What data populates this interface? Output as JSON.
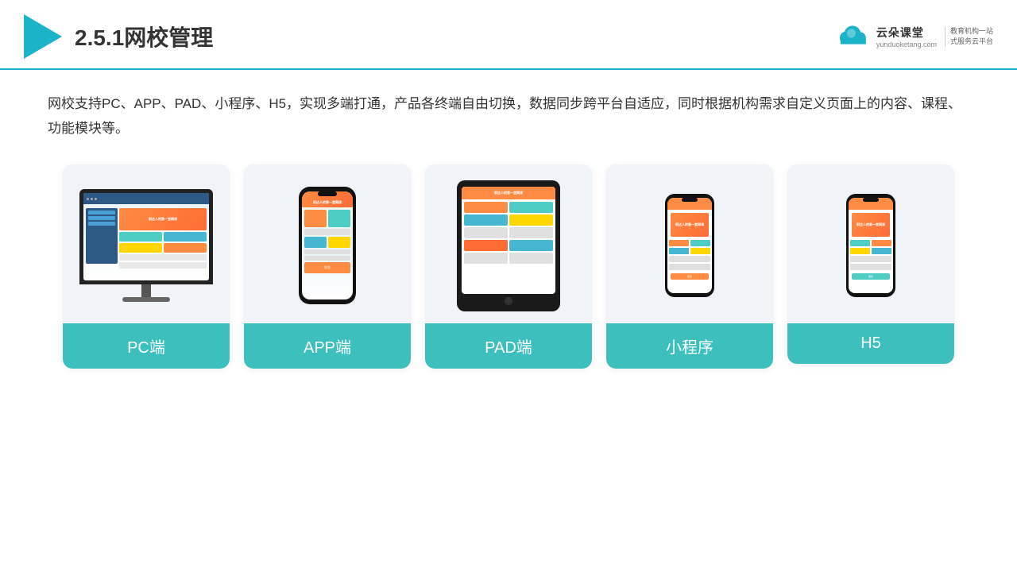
{
  "header": {
    "title": "2.5.1网校管理",
    "logo_main": "云朵课堂",
    "logo_url": "yunduoketang.com",
    "logo_tagline_line1": "教育机构一站",
    "logo_tagline_line2": "式服务云平台"
  },
  "description": "网校支持PC、APP、PAD、小程序、H5，实现多端打通，产品各终端自由切换，数据同步跨平台自适应，同时根据机构需求自定义页面上的内容、课程、功能模块等。",
  "cards": [
    {
      "id": "pc",
      "label": "PC端"
    },
    {
      "id": "app",
      "label": "APP端"
    },
    {
      "id": "pad",
      "label": "PAD端"
    },
    {
      "id": "miniprogram",
      "label": "小程序"
    },
    {
      "id": "h5",
      "label": "H5"
    }
  ],
  "accent_color": "#3dbfbe"
}
